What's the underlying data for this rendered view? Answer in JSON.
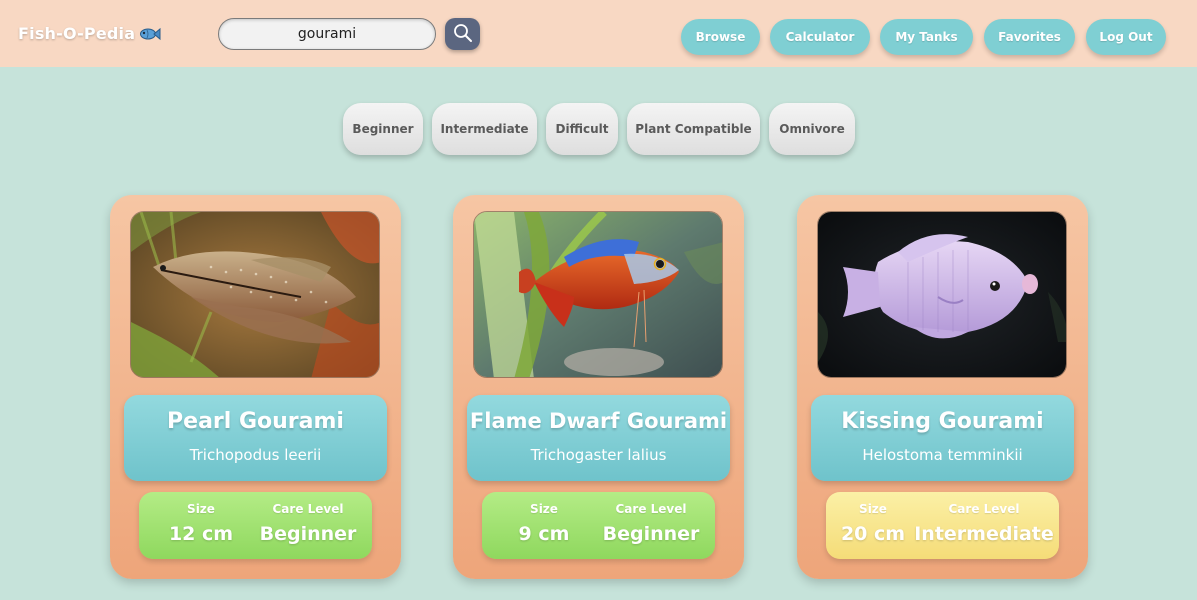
{
  "header": {
    "logo_text": "Fish-O-Pedia",
    "logo_icon": "fish-icon",
    "search": {
      "value": "gourami",
      "icon": "search-icon"
    },
    "nav": [
      {
        "label": "Browse"
      },
      {
        "label": "Calculator"
      },
      {
        "label": "My Tanks"
      },
      {
        "label": "Favorites"
      },
      {
        "label": "Log Out"
      }
    ]
  },
  "filters": [
    {
      "label": "Beginner"
    },
    {
      "label": "Intermediate"
    },
    {
      "label": "Difficult"
    },
    {
      "label": "Plant Compatible"
    },
    {
      "label": "Omnivore"
    }
  ],
  "cards": [
    {
      "common_name": "Pearl Gourami",
      "scientific_name": "Trichopodus leerii",
      "size_label": "Size",
      "size_value": "12 cm",
      "care_label": "Care Level",
      "care_value": "Beginner",
      "care_color": "#9bdf6a"
    },
    {
      "common_name": "Flame Dwarf Gourami",
      "scientific_name": "Trichogaster lalius",
      "size_label": "Size",
      "size_value": "9 cm",
      "care_label": "Care Level",
      "care_value": "Beginner",
      "care_color": "#9bdf6a"
    },
    {
      "common_name": "Kissing Gourami",
      "scientific_name": "Helostoma temminkii",
      "size_label": "Size",
      "size_value": "20 cm",
      "care_label": "Care Level",
      "care_value": "Intermediate",
      "care_color": "#f8e38a"
    }
  ],
  "colors": {
    "header_bg": "#f8d8c3",
    "page_bg": "#c6e3da",
    "nav_button": "#7fcfd3",
    "card_bg": "#f0b088",
    "name_box": "#7fcfd3",
    "search_button": "#5b6680"
  }
}
